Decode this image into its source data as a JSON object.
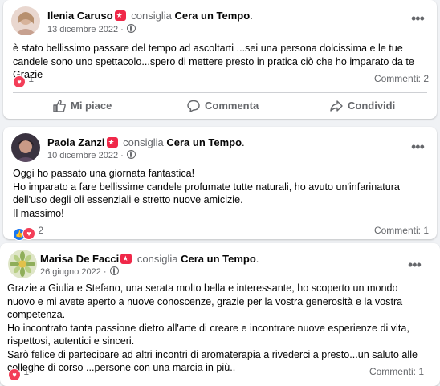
{
  "posts": [
    {
      "author": "Ilenia Caruso",
      "recommends": "consiglia",
      "page": "Cera un Tempo",
      "date": "13 dicembre 2022",
      "text": [
        "è stato bellissimo passare del tempo ad ascoltarti ...sei una persona dolcissima e le tue candele sono uno spettacolo...spero di mettere presto in pratica ciò che ho imparato da te Grazie"
      ],
      "reactions_count": "1",
      "comments": "Commenti: 2",
      "actions": [
        "Mi piace",
        "Commenta",
        "Condividi"
      ]
    },
    {
      "author": "Paola Zanzi",
      "recommends": "consiglia",
      "page": "Cera un Tempo",
      "date": "10 dicembre 2022",
      "text": [
        "Oggi ho passato una giornata fantastica!",
        "Ho imparato a fare bellissime candele profumate tutte naturali, ho avuto un'infarinatura dell'uso degli oli essenziali e stretto nuove amicizie.",
        "Il massimo!"
      ],
      "reactions_count": "2",
      "comments": "Commenti: 1"
    },
    {
      "author": "Marisa De Facci",
      "recommends": "consiglia",
      "page": "Cera un Tempo",
      "date": "26 giugno 2022",
      "text": [
        "Grazie a Giulia e Stefano, una serata molto bella e interessante, ho scoperto un mondo nuovo e mi avete aperto a nuove conoscenze, grazie per la vostra generosità e la vostra competenza.",
        "Ho incontrato tanta passione dietro all'arte di creare e incontrare nuove esperienze di vita, rispettosi, autentici e sinceri.",
        "Sarò felice di partecipare ad altri incontri di  aromaterapia a rivederci a presto...un saluto alle colleghe di corso ...persone con una marcia in più.."
      ],
      "reactions_count": "1",
      "comments": "Commenti: 1"
    }
  ],
  "colors": {
    "heart": "#f33e58",
    "like": "#1877f2",
    "muted": "#65676b",
    "badge": "#f02849"
  }
}
